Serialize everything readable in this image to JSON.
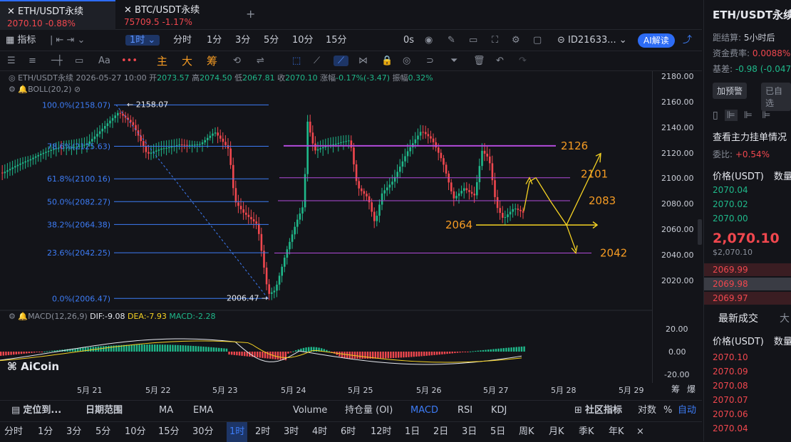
{
  "tabs": [
    {
      "symbol": "ETH/USDT永续",
      "price": "2070.10",
      "change": "-0.88%"
    },
    {
      "symbol": "BTC/USDT永续",
      "price": "75709.5",
      "change": "-1.17%"
    }
  ],
  "add_tab": "+",
  "toolbar": {
    "indicator": "指标",
    "timeframe": "1时",
    "items": [
      "分时",
      "1分",
      "3分",
      "5分",
      "10分",
      "15分"
    ],
    "zero_s": "0s",
    "account": "ID21633...",
    "ai": "AI解读"
  },
  "drawbar": {
    "zhu": "主",
    "da": "大",
    "chou": "筹"
  },
  "chart_info": {
    "symbol": "ETH/USDT永续",
    "datetime": "2026-05-27 10:00",
    "open_label": "开",
    "open": "2073.57",
    "high_label": "高",
    "high": "2074.50",
    "low_label": "低",
    "low": "2067.81",
    "close_label": "收",
    "close": "2070.10",
    "chg_label": "涨幅",
    "chg": "-0.17%(-3.47)",
    "amp_label": "振幅",
    "amp": "0.32%",
    "boll": "BOLL(20,2)"
  },
  "macd_info": {
    "name": "MACD(12,26,9)",
    "dif": "DIF:-9.08",
    "dea": "DEA:-7.93",
    "macd": "MACD:-2.28"
  },
  "watermark": "AiCoin",
  "fib_levels": [
    {
      "label": "100.0%(2158.07)",
      "price": 2158.07
    },
    {
      "label": "78.6%(2125.63)",
      "price": 2125.63
    },
    {
      "label": "61.8%(2100.16)",
      "price": 2100.16
    },
    {
      "label": "50.0%(2082.27)",
      "price": 2082.27
    },
    {
      "label": "38.2%(2064.38)",
      "price": 2064.38
    },
    {
      "label": "23.6%(2042.25)",
      "price": 2042.25
    },
    {
      "label": "0.0%(2006.47)",
      "price": 2006.47
    }
  ],
  "high_marker": "2158.07",
  "low_marker": "2006.47",
  "annotations": [
    "2126",
    "2101",
    "2083",
    "2064",
    "2042"
  ],
  "price_axis": [
    "2180.00",
    "2160.00",
    "2140.00",
    "2120.00",
    "2100.00",
    "2080.00",
    "2060.00",
    "2040.00",
    "2020.00"
  ],
  "macd_axis": [
    "20.00",
    "0.00",
    "-20.00"
  ],
  "x_axis": [
    "5月 21",
    "5月 22",
    "5月 23",
    "5月 24",
    "5月 25",
    "5月 26",
    "5月 27",
    "5月 28",
    "5月 29"
  ],
  "x_axis_right": [
    "筹",
    "爆"
  ],
  "bottom_bar1": {
    "locate": "定位到...",
    "range": "日期范围",
    "items": [
      "MA",
      "EMA",
      "Volume",
      "持仓量 (OI)",
      "MACD",
      "RSI",
      "KDJ"
    ],
    "community": "社区指标",
    "log": "对数",
    "pct": "%",
    "auto": "自动"
  },
  "bottom_bar2": [
    "分时",
    "1分",
    "3分",
    "5分",
    "10分",
    "15分",
    "30分",
    "1时",
    "2时",
    "3时",
    "4时",
    "6时",
    "12时",
    "1日",
    "2日",
    "3日",
    "5日",
    "周K",
    "月K",
    "季K",
    "年K",
    "×"
  ],
  "right_panel": {
    "title": "ETH/USDT永续",
    "settle_label": "距结算",
    "settle": "5小时后",
    "funding_label": "资金费率",
    "funding": "0.0088%",
    "basis_label": "基差",
    "basis": "-0.98 (-0.047",
    "alert_btn": "加预警",
    "selected_btn": "已自选",
    "orderbook_title": "查看主力挂单情况",
    "ratio_label": "委比",
    "ratio": "+0.54%",
    "price_header": "价格(USDT)",
    "qty_header": "数量",
    "bids": [
      "2070.04",
      "2070.02",
      "2070.00"
    ],
    "last_price": "2,070.10",
    "last_price_usd": "$2,070.10",
    "asks": [
      "2069.99",
      "2069.98",
      "2069.97"
    ],
    "trades_title": "最新成交",
    "trades_extra": "大",
    "trades": [
      "2070.10",
      "2070.09",
      "2070.08",
      "2070.07",
      "2070.06",
      "2070.04"
    ]
  },
  "colors": {
    "up": "#1fb88a",
    "down": "#f0474e",
    "accent": "#3d7cf6",
    "fib": "#3d7cf6",
    "purple": "#b24bdb",
    "orange": "#f59b23",
    "yellow": "#f5d223"
  }
}
